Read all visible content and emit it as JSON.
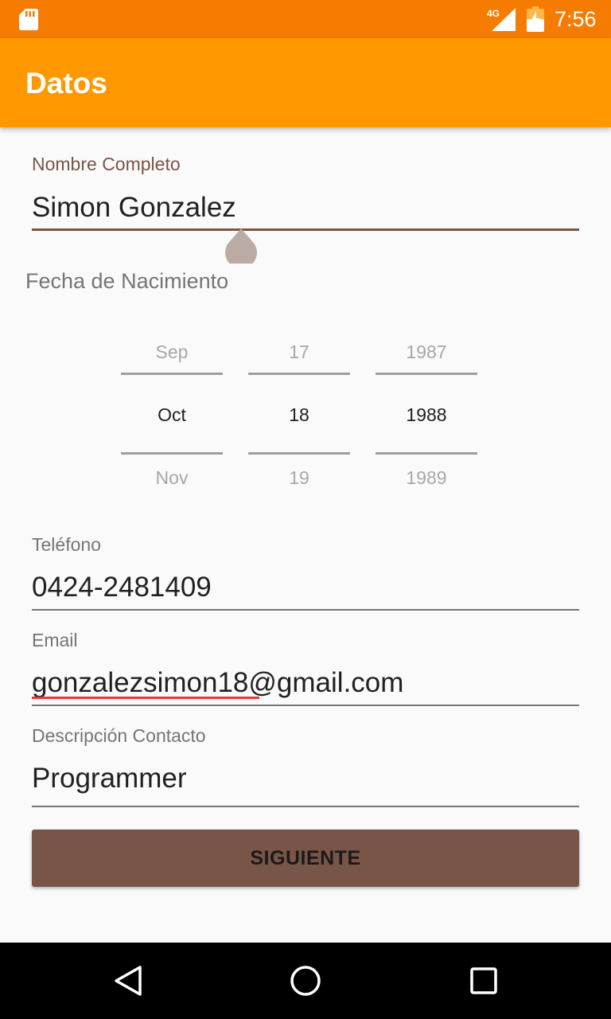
{
  "status_bar": {
    "network": "4G",
    "time": "7:56",
    "icons": [
      "sd-card-icon",
      "signal-icon",
      "battery-icon"
    ]
  },
  "app_bar": {
    "title": "Datos"
  },
  "form": {
    "name": {
      "label": "Nombre Completo",
      "value": "Simon Gonzalez"
    },
    "birth_date": {
      "label": "Fecha de Nacimiento",
      "month": {
        "prev": "Sep",
        "selected": "Oct",
        "next": "Nov"
      },
      "day": {
        "prev": "17",
        "selected": "18",
        "next": "19"
      },
      "year": {
        "prev": "1987",
        "selected": "1988",
        "next": "1989"
      }
    },
    "phone": {
      "label": "Teléfono",
      "value": "0424-2481409"
    },
    "email": {
      "label": "Email",
      "value": "gonzalezsimon18@gmail.com"
    },
    "description": {
      "label": "Descripción Contacto",
      "value": "Programmer"
    },
    "next_button": {
      "label": "SIGUIENTE"
    }
  },
  "nav_bar": {
    "icons": [
      "back-icon",
      "home-icon",
      "recents-icon"
    ]
  },
  "colors": {
    "status_bar": "#f57c00",
    "app_bar": "#ff9800",
    "accent": "#795548",
    "spell_error": "#e53935"
  }
}
